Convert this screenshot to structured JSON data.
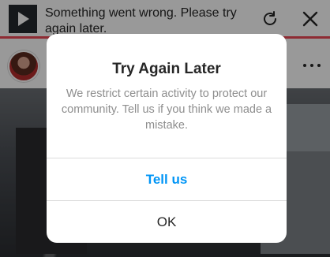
{
  "banner": {
    "error_text": "Something went wrong. Please try again later.",
    "play_icon": "play-icon",
    "refresh_icon": "refresh-icon",
    "close_icon": "close-icon",
    "progress_percent": 100,
    "progress_color": "#ed4956"
  },
  "post": {
    "avatar_icon": "avatar",
    "more_icon": "more-horizontal-icon"
  },
  "dialog": {
    "title": "Try Again Later",
    "message": "We restrict certain activity to protect our community. Tell us if you think we made a mistake.",
    "primary_button": "Tell us",
    "secondary_button": "OK",
    "primary_color": "#0095f6"
  }
}
